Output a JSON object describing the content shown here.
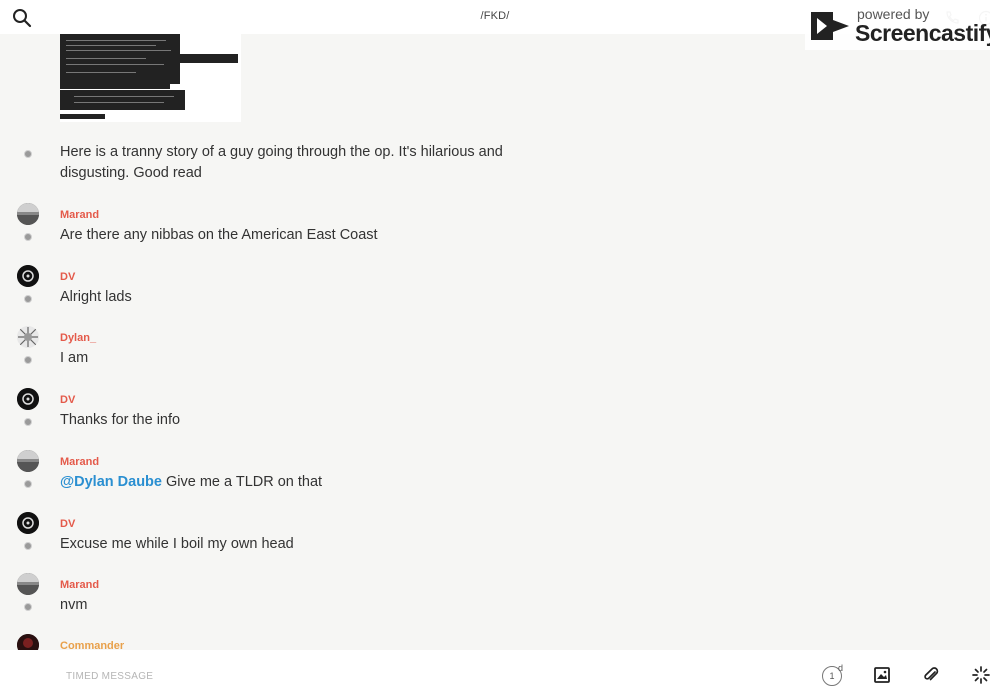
{
  "header": {
    "channel_title": "/FKD/",
    "search_icon": "search-icon",
    "phone_icon": "phone-icon",
    "info_icon": "info-icon"
  },
  "watermark": {
    "top": "powered by",
    "brand": "Screencastify"
  },
  "messages": [
    {
      "author": "",
      "text": "Here is a tranny story of a guy going through the op. It's hilarious and disgusting. Good read",
      "avatar": ""
    },
    {
      "author": "Marand",
      "text": "Are there any nibbas on the American East Coast",
      "avatar": "landscape"
    },
    {
      "author": "DV",
      "text": "Alright lads",
      "avatar": "dark"
    },
    {
      "author": "Dylan_",
      "text": "I am",
      "avatar": "pattern"
    },
    {
      "author": "DV",
      "text": "Thanks for the info",
      "avatar": "dark"
    },
    {
      "author": "Marand",
      "mention": "@Dylan Daube",
      "text": " Give me a TLDR on that",
      "avatar": "landscape"
    },
    {
      "author": "DV",
      "text": "Excuse me while I boil my own head",
      "avatar": "dark"
    },
    {
      "author": "Marand",
      "text": "nvm",
      "avatar": "landscape"
    },
    {
      "author": "Commander",
      "text": "",
      "avatar": "red-dark"
    }
  ],
  "composer": {
    "placeholder": "TIMED MESSAGE",
    "timer_value": "1",
    "timer_unit": "d",
    "image_icon": "image-icon",
    "attach_icon": "paperclip-icon",
    "sparkle_icon": "sparkle-icon"
  },
  "colors": {
    "author": "#e45a4a",
    "author_alt": "#e8a04a",
    "mention": "#2a8fd1",
    "background": "#f6f6f4"
  }
}
